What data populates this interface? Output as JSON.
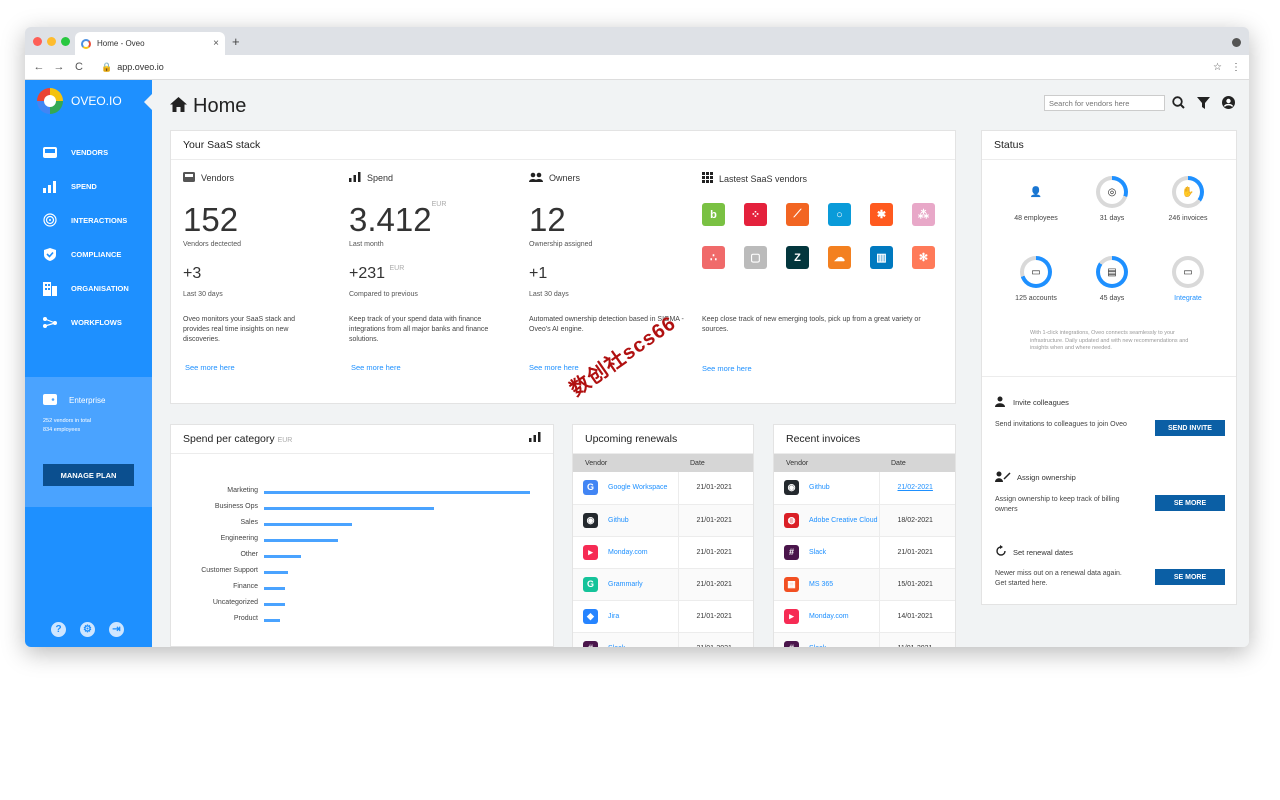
{
  "browser": {
    "tab_title": "Home - Oveo",
    "tab_close": "×",
    "new_tab": "+",
    "url": "app.oveo.io",
    "nav": {
      "back": "←",
      "forward": "→",
      "reload": "C"
    }
  },
  "sidebar": {
    "brand": "OVEO.IO",
    "items": [
      {
        "label": "VENDORS",
        "icon": "inbox-icon"
      },
      {
        "label": "SPEND",
        "icon": "bar-chart-icon"
      },
      {
        "label": "INTERACTIONS",
        "icon": "fingerprint-icon"
      },
      {
        "label": "COMPLIANCE",
        "icon": "shield-check-icon"
      },
      {
        "label": "ORGANISATION",
        "icon": "building-icon"
      },
      {
        "label": "WORKFLOWS",
        "icon": "workflow-icon"
      }
    ],
    "plan": {
      "title": "Enterprise",
      "line1": "252 vendors in total",
      "line2": "834 employees",
      "button": "MANAGE PLAN"
    }
  },
  "header": {
    "title": "Home",
    "search_placeholder": "Search for vendors here"
  },
  "stack": {
    "title": "Your SaaS stack",
    "vendors": {
      "head": "Vendors",
      "value": "152",
      "label": "Vendors dectected",
      "delta": "+3",
      "delta_label": "Last 30 days",
      "desc": "Oveo monitors your SaaS stack and provides real time insights on new discoveries.",
      "link": "See more here"
    },
    "spend": {
      "head": "Spend",
      "value": "3.412",
      "currency": "EUR",
      "label": "Last month",
      "delta": "+231",
      "delta_currency": "EUR",
      "delta_label": "Compared to previous",
      "desc": "Keep track of your spend data with finance integrations from all major banks and finance solutions.",
      "link": "See more here"
    },
    "owners": {
      "head": "Owners",
      "value": "12",
      "label": "Ownership assigned",
      "delta": "+1",
      "delta_label": "Last 30 days",
      "desc": "Automated ownership detection based in SIGMA - Oveo's AI engine.",
      "link": "See more here"
    },
    "latest": {
      "head": "Lastest SaaS vendors",
      "desc": "Keep close track of new emerging tools, pick up from a great variety or sources.",
      "link": "See more here",
      "logos": [
        {
          "glyph": "b",
          "color": "#7ac143",
          "icon": "bitbucket-logo-icon"
        },
        {
          "glyph": "⁘",
          "color": "#e4213c",
          "icon": "twilio-logo-icon"
        },
        {
          "glyph": "⟋",
          "color": "#f26522",
          "icon": "postman-logo-icon"
        },
        {
          "glyph": "○",
          "color": "#0a9bd9",
          "icon": "circle-logo-icon"
        },
        {
          "glyph": "✱",
          "color": "#ff5a1f",
          "icon": "zapier-logo-icon"
        },
        {
          "glyph": "⁂",
          "color": "#e8a8c8",
          "icon": "slack-dots-logo-icon"
        },
        {
          "glyph": "∴",
          "color": "#f06a6a",
          "icon": "asana-logo-icon"
        },
        {
          "glyph": "▢",
          "color": "#bbbbbb",
          "icon": "calendar-logo-icon"
        },
        {
          "glyph": "Z",
          "color": "#03363d",
          "icon": "zendesk-logo-icon"
        },
        {
          "glyph": "☁",
          "color": "#f38020",
          "icon": "cloudflare-logo-icon"
        },
        {
          "glyph": "▥",
          "color": "#0079bf",
          "icon": "trello-logo-icon"
        },
        {
          "glyph": "✻",
          "color": "#ff7a59",
          "icon": "hubspot-logo-icon"
        }
      ]
    }
  },
  "status": {
    "title": "Status",
    "items": [
      {
        "label": "48 employees",
        "icon": "employees-icon",
        "glyph": "👤",
        "fill": 0
      },
      {
        "label": "31 days",
        "icon": "fingerprint-icon",
        "glyph": "◎",
        "fill": 0.3
      },
      {
        "label": "246 invoices",
        "icon": "hand-icon",
        "glyph": "✋",
        "fill": 0.35
      },
      {
        "label": "125 accounts",
        "icon": "wallet-icon",
        "glyph": "▭",
        "fill": 0.7
      },
      {
        "label": "45 days",
        "icon": "document-icon",
        "glyph": "▤",
        "fill": 0.85
      },
      {
        "label": "Integrate",
        "icon": "integrate-icon",
        "glyph": "▭",
        "fill": 0
      }
    ],
    "note": "With 1-click integrations, Oveo connects seamlessly to your infrastructure. Daily updated and with new recommendations and insights when and where needed.",
    "actions": [
      {
        "head": "Invite colleagues",
        "icon": "invite-user-icon",
        "desc": "Send invitations to colleagues to join Oveo",
        "button": "SEND INVITE"
      },
      {
        "head": "Assign ownership",
        "icon": "assign-owner-icon",
        "desc": "Assign ownership to keep track of billing owners",
        "button": "SE MORE"
      },
      {
        "head": "Set renewal dates",
        "icon": "refresh-icon",
        "desc": "Newer miss out on a renewal data again. Get started here.",
        "button": "SE MORE"
      }
    ]
  },
  "spend_category": {
    "title": "Spend per category",
    "currency": "EUR"
  },
  "chart_data": {
    "type": "bar",
    "orientation": "horizontal",
    "title": "Spend per category",
    "categories": [
      "Marketing",
      "Business Ops",
      "Sales",
      "Engineering",
      "Other",
      "Customer Support",
      "Finance",
      "Uncategorized",
      "Product"
    ],
    "values": [
      100,
      64,
      33,
      28,
      14,
      9,
      8,
      8,
      6
    ],
    "xlim": [
      0,
      100
    ],
    "color": "#4aa3ff"
  },
  "renewals": {
    "title": "Upcoming renewals",
    "headers": [
      "Vendor",
      "Date"
    ],
    "rows": [
      {
        "vendor": "Google Workspace",
        "date": "21/01-2021",
        "icon": "google-icon",
        "glyph": "G",
        "color": "#4285f4"
      },
      {
        "vendor": "Github",
        "date": "21/01-2021",
        "icon": "github-icon",
        "glyph": "◉",
        "color": "#24292e"
      },
      {
        "vendor": "Monday.com",
        "date": "21/01-2021",
        "icon": "monday-icon",
        "glyph": "▸",
        "color": "#f62b54"
      },
      {
        "vendor": "Grammarly",
        "date": "21/01-2021",
        "icon": "grammarly-icon",
        "glyph": "G",
        "color": "#15c39a"
      },
      {
        "vendor": "Jira",
        "date": "21/01-2021",
        "icon": "jira-icon",
        "glyph": "◆",
        "color": "#2684ff"
      },
      {
        "vendor": "Slack",
        "date": "21/01-2021",
        "icon": "slack-icon",
        "glyph": "#",
        "color": "#4a154b"
      }
    ]
  },
  "invoices": {
    "title": "Recent invoices",
    "headers": [
      "Vendor",
      "Date"
    ],
    "rows": [
      {
        "vendor": "Github",
        "date": "21/02-2021",
        "link": true,
        "icon": "github-icon",
        "glyph": "◉",
        "color": "#24292e"
      },
      {
        "vendor": "Adobe Creative Cloud",
        "date": "18/02-2021",
        "icon": "adobe-icon",
        "glyph": "◍",
        "color": "#da1f26"
      },
      {
        "vendor": "Slack",
        "date": "21/01-2021",
        "icon": "slack-icon",
        "glyph": "#",
        "color": "#4a154b"
      },
      {
        "vendor": "MS 365",
        "date": "15/01-2021",
        "icon": "microsoft-icon",
        "glyph": "▦",
        "color": "#f25022"
      },
      {
        "vendor": "Monday.com",
        "date": "14/01-2021",
        "icon": "monday-icon",
        "glyph": "▸",
        "color": "#f62b54"
      },
      {
        "vendor": "Slack",
        "date": "11/01-2021",
        "icon": "slack-icon",
        "glyph": "#",
        "color": "#4a154b"
      }
    ]
  },
  "watermark": "数创社scs66"
}
